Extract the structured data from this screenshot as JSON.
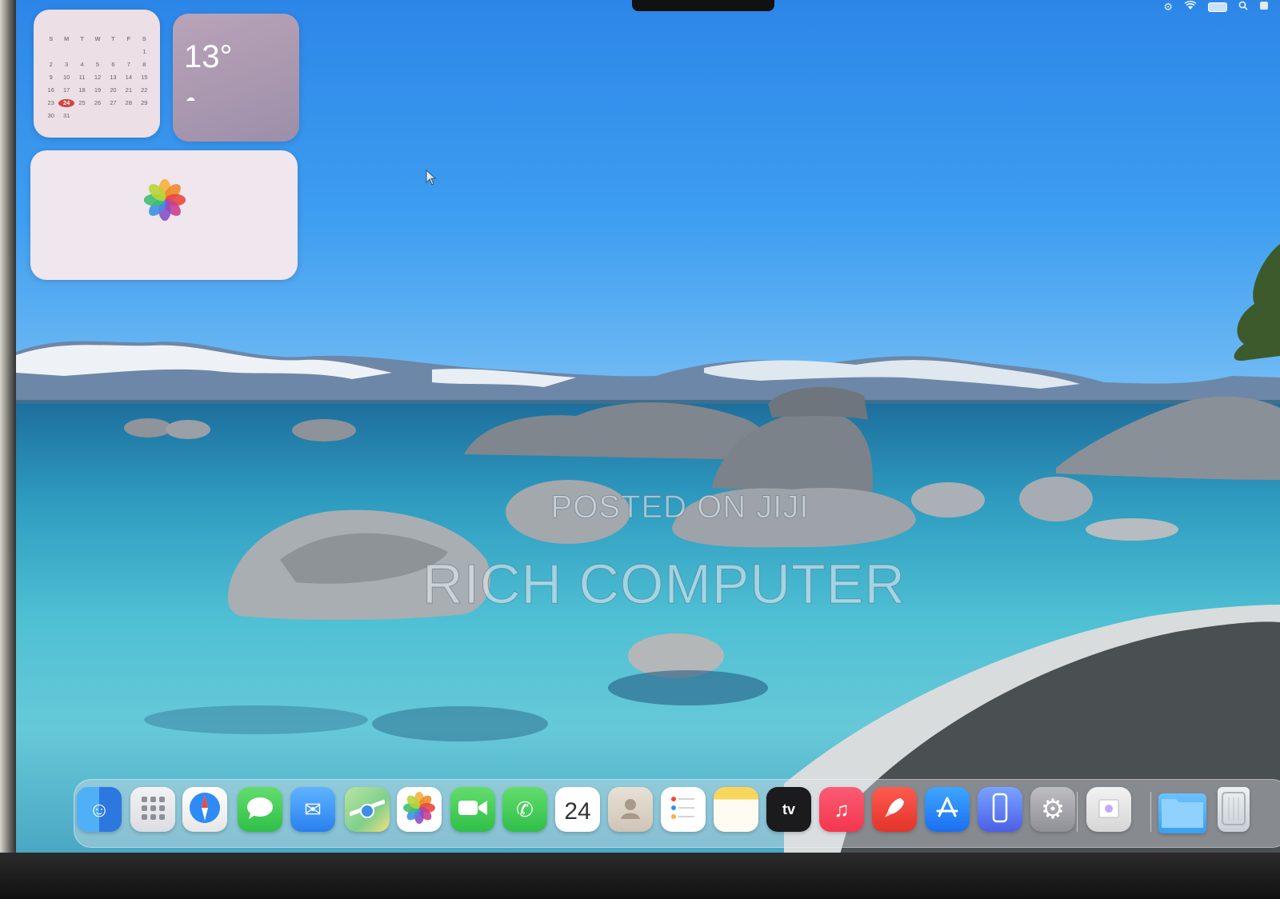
{
  "screen": {
    "watermark_line1": "POSTED ON JIJI",
    "watermark_line2": "RICH COMPUTER"
  },
  "menubar": {
    "icons": [
      "control-center-icon",
      "wifi-icon",
      "battery-icon",
      "search-icon",
      "user-icon"
    ]
  },
  "widgets": {
    "calendar": {
      "weekday_headers": [
        "S",
        "M",
        "T",
        "W",
        "T",
        "F",
        "S"
      ],
      "days": [
        "",
        "",
        "",
        "",
        "",
        "",
        "1",
        "2",
        "3",
        "4",
        "5",
        "6",
        "7",
        "8",
        "9",
        "10",
        "11",
        "12",
        "13",
        "14",
        "15",
        "16",
        "17",
        "18",
        "19",
        "20",
        "21",
        "22",
        "23",
        "24",
        "25",
        "26",
        "27",
        "28",
        "29",
        "30",
        "31"
      ],
      "today": "24"
    },
    "weather": {
      "temperature": "13°"
    },
    "photos": {}
  },
  "dock": {
    "items": [
      {
        "name": "finder",
        "icon": "finder-icon"
      },
      {
        "name": "launchpad",
        "icon": "launchpad-icon"
      },
      {
        "name": "safari",
        "icon": "safari-icon"
      },
      {
        "name": "messages",
        "icon": "messages-icon"
      },
      {
        "name": "mail",
        "icon": "mail-icon"
      },
      {
        "name": "maps",
        "icon": "maps-icon"
      },
      {
        "name": "photos",
        "icon": "photos-icon"
      },
      {
        "name": "facetime",
        "icon": "facetime-icon"
      },
      {
        "name": "phone",
        "icon": "phone-icon"
      },
      {
        "name": "calendar",
        "icon": "calendar-icon",
        "day": "24"
      },
      {
        "name": "contacts",
        "icon": "contacts-icon"
      },
      {
        "name": "reminders",
        "icon": "reminders-icon"
      },
      {
        "name": "notes",
        "icon": "notes-icon"
      },
      {
        "name": "apple-tv",
        "icon": "apple-tv-icon",
        "label": "tv"
      },
      {
        "name": "music",
        "icon": "music-icon"
      },
      {
        "name": "rocket-typist",
        "icon": "rocket-icon"
      },
      {
        "name": "app-store",
        "icon": "app-store-icon"
      },
      {
        "name": "iphone-mirroring",
        "icon": "iphone-mirroring-icon"
      },
      {
        "name": "system-settings",
        "icon": "gear-icon"
      },
      {
        "name": "preview",
        "icon": "preview-icon"
      },
      {
        "name": "downloads-folder",
        "icon": "folder-icon"
      },
      {
        "name": "trash",
        "icon": "trash-icon"
      }
    ]
  },
  "colors": {
    "sky": "#2c86e8",
    "water": "#4fc0d4",
    "calendar_today": "#d9413d"
  }
}
